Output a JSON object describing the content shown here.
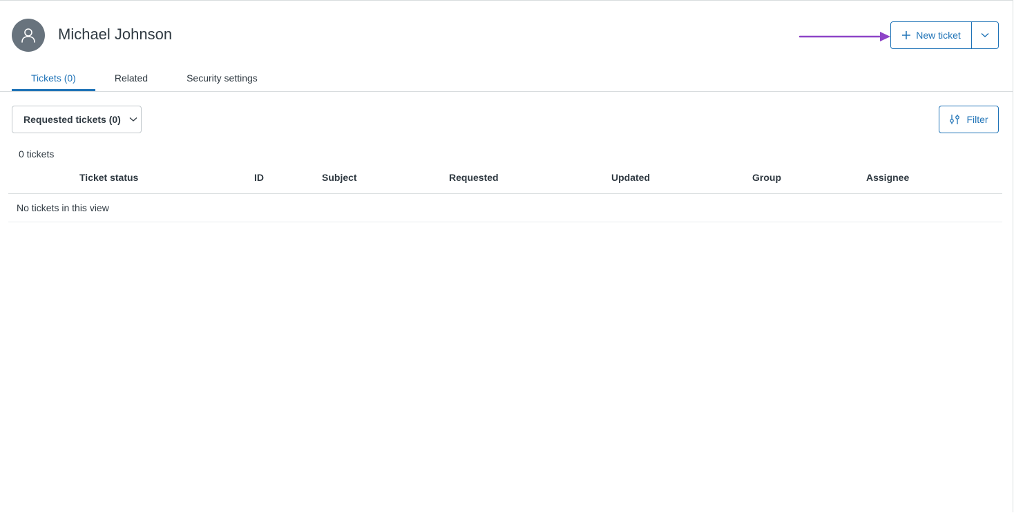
{
  "user": {
    "name": "Michael Johnson",
    "avatar_icon": "user-icon"
  },
  "actions": {
    "new_ticket_label": "New ticket",
    "new_ticket_icon": "plus-icon",
    "menu_icon": "chevron-down-icon"
  },
  "tabs": [
    {
      "label": "Tickets (0)",
      "active": true
    },
    {
      "label": "Related",
      "active": false
    },
    {
      "label": "Security settings",
      "active": false
    }
  ],
  "view": {
    "selected": "Requested tickets (0)",
    "filter_label": "Filter",
    "count_text": "0 tickets"
  },
  "table": {
    "columns": [
      "Ticket status",
      "ID",
      "Subject",
      "Requested",
      "Updated",
      "Group",
      "Assignee"
    ],
    "empty_text": "No tickets in this view"
  },
  "colors": {
    "accent": "#1f73b7",
    "annotation_arrow": "#8e44c7",
    "avatar_bg": "#68737d",
    "text": "#2f3941",
    "border": "#d8dcde"
  }
}
